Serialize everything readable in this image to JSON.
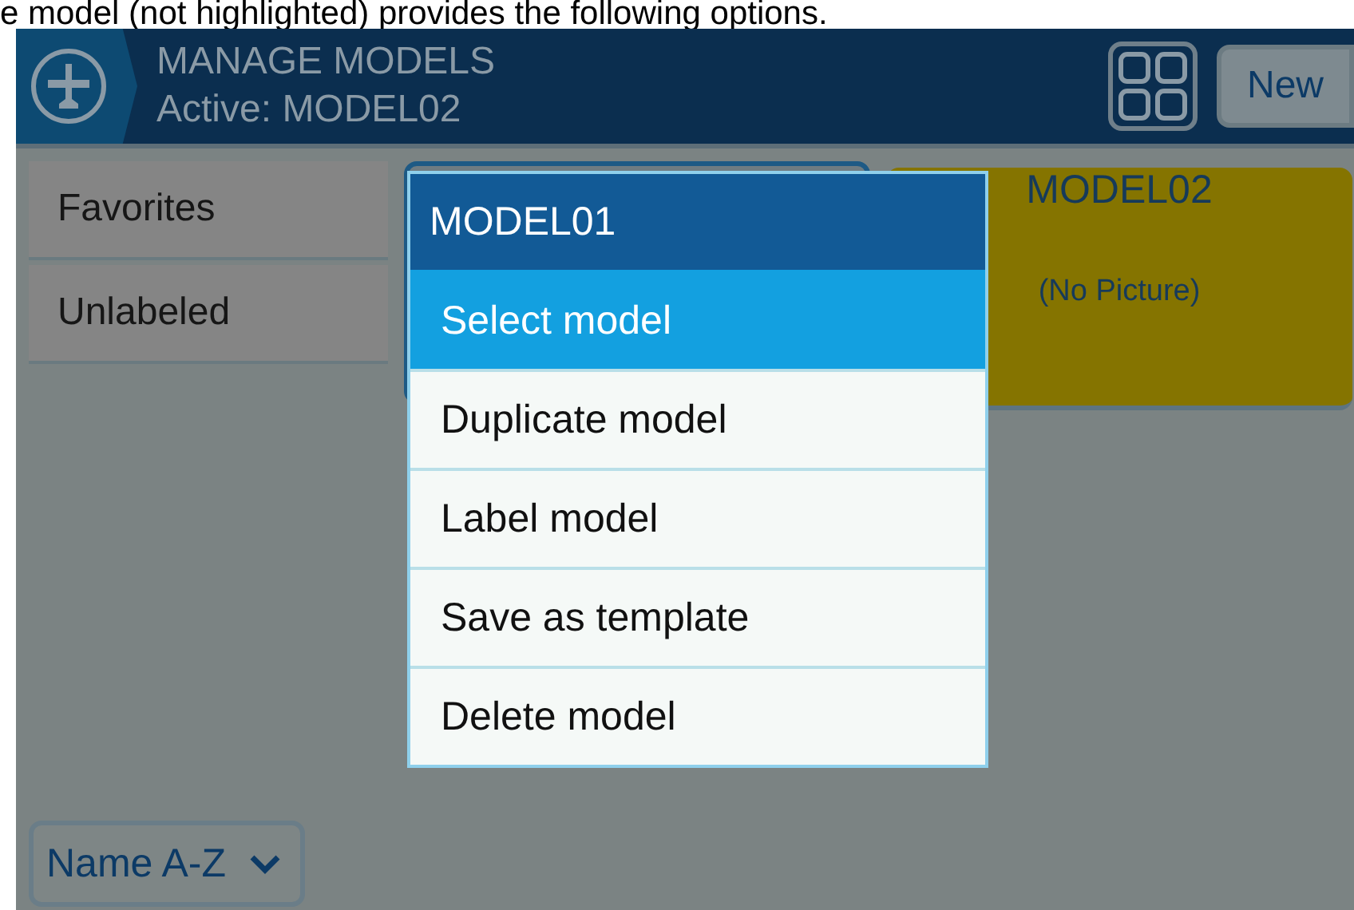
{
  "caption": "e model (not highlighted) provides the following options.",
  "header": {
    "title": "MANAGE MODELS",
    "subtitle": "Active: MODEL02",
    "new_button": "New"
  },
  "labels": [
    {
      "label": "Favorites"
    },
    {
      "label": "Unlabeled"
    }
  ],
  "models": [
    {
      "name": "MODEL02",
      "picture": "(No Picture)"
    }
  ],
  "menu": {
    "title": "MODEL01",
    "items": [
      {
        "label": "Select model",
        "selected": true
      },
      {
        "label": "Duplicate model",
        "selected": false
      },
      {
        "label": "Label model",
        "selected": false
      },
      {
        "label": "Save as template",
        "selected": false
      },
      {
        "label": "Delete model",
        "selected": false
      }
    ]
  },
  "sort": {
    "value": "Name A-Z"
  }
}
